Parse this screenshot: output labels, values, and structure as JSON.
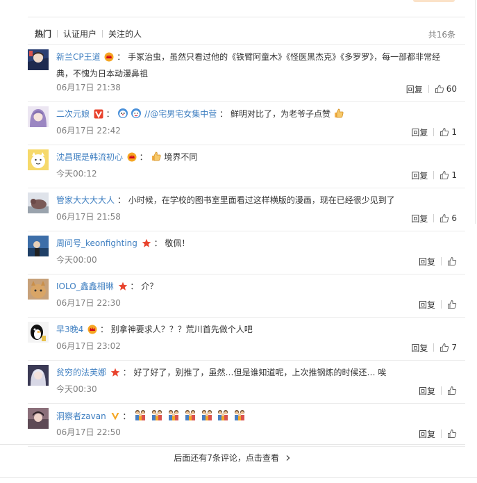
{
  "tabs": {
    "hot": "热门",
    "verified": "认证用户",
    "following": "关注的人"
  },
  "total": "共16条",
  "comments": [
    {
      "user": "新兰CP王道",
      "badge": "crown-badge-icon",
      "sep": "：",
      "text": "手冢治虫，虽然只看过他的《铁臂阿童木》《怪医黑杰克》《多罗罗》，每一部都非常经典，不愧为日本动漫鼻祖",
      "time": "06月17日 21:38",
      "reply": "回复",
      "likes": "60"
    },
    {
      "user": "二次元娘",
      "badge": "verified-v-badge-icon",
      "sep": "：",
      "mention": "//@宅男宅女集中营",
      "text": "鲜明对比了，为老爷子点赞",
      "time": "06月17日 22:42",
      "reply": "回复",
      "likes": "1"
    },
    {
      "user": "沈昌珉是韩流初心",
      "badge": "crown-badge-icon",
      "sep": "：",
      "text": "境界不同",
      "time": "今天00:12",
      "reply": "回复",
      "likes": "1"
    },
    {
      "user": "管家大大大大人",
      "badge": "",
      "sep": "：",
      "text": "小时候，在学校的图书室里面看过这样横版的漫画，现在已经很少见到了",
      "time": "06月17日 21:58",
      "reply": "回复",
      "likes": "6"
    },
    {
      "user": "周问号_keonfighting",
      "badge": "star-badge-icon",
      "sep": "：",
      "text": "敬佩！",
      "time": "今天00:00",
      "reply": "回复",
      "likes": ""
    },
    {
      "user": "IOLO_鑫鑫相琳",
      "badge": "star-badge-icon",
      "sep": "：",
      "text": "介？",
      "time": "06月17日 22:30",
      "reply": "回复",
      "likes": ""
    },
    {
      "user": "早3晚4",
      "badge": "crown-badge-icon",
      "sep": "：",
      "text": "别拿神要求人？？？荒川首先做个人吧",
      "time": "06月17日 23:02",
      "reply": "回复",
      "likes": "7"
    },
    {
      "user": "贫穷的法芙娜",
      "badge": "star-badge-icon",
      "sep": "：",
      "text": "好了好了，别推了，虽然…但是谁知道呢，上次推钢炼的时候还… 唉",
      "time": "今天00:30",
      "reply": "回复",
      "likes": ""
    },
    {
      "user": "洞察者zavan",
      "badge": "verified-gold-v-badge-icon",
      "sep": "：",
      "text": "",
      "time": "06月17日 22:50",
      "reply": "回复",
      "likes": ""
    }
  ],
  "more": "后面还有7条评论，点击查看",
  "colors": {
    "link": "#3f7fc1",
    "muted": "#808080",
    "divider": "#ececec"
  }
}
